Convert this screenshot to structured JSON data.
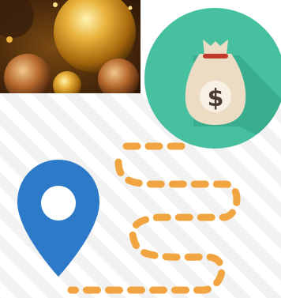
{
  "colors": {
    "teal_circle": "#46c09f",
    "teal_shadow": "#2f9e82",
    "moneybag": "#eddcc4",
    "moneybag_tie": "#c0392b",
    "dollar_badge": "#f7f0e3",
    "dollar_sign": "#4a3b33",
    "map_pin": "#2d7bc8",
    "route_dash": "#f0a541",
    "stripe": "#f1f1f1"
  },
  "icons": {
    "photo": "christmas-ornaments-photo",
    "money": "money-bag-icon",
    "dollar": "dollar-sign-icon",
    "pin": "map-pin-icon",
    "route": "dashed-route-icon"
  },
  "money_bag": {
    "currency_symbol": "$"
  }
}
